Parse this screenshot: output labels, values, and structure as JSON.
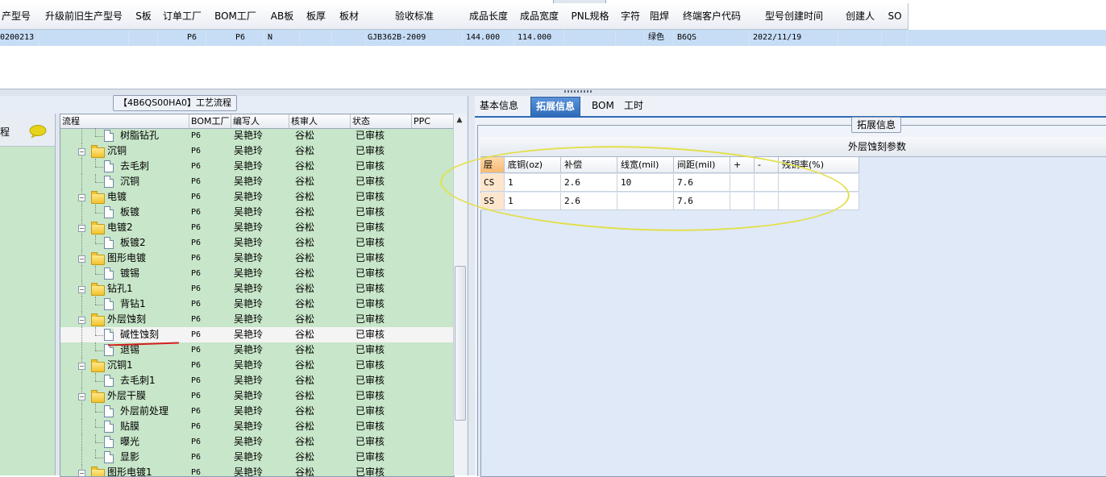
{
  "top_grid": {
    "headers": [
      "产型号",
      "升级前旧生产型号",
      "S板",
      "订单工厂",
      "BOM工厂",
      "AB板",
      "板厚",
      "板材",
      "验收标准",
      "成品长度",
      "成品宽度",
      "PNL规格",
      "字符",
      "阻焊",
      "终端客户代码",
      "型号创建时间",
      "创建人",
      "SO"
    ],
    "row": [
      "0200213",
      "",
      "",
      "P6",
      "P6",
      "N",
      "",
      "",
      "GJB362B-2009",
      "144.000",
      "114.000",
      "",
      "",
      "绿色",
      "B6QS",
      "2022/11/19",
      "",
      ""
    ]
  },
  "flow_panel": {
    "title": "【4B6QS00HA0】工艺流程",
    "side_label": "程",
    "side_icon": "chat-bubble-icon",
    "columns": [
      "流程",
      "BOM工厂",
      "编写人",
      "核审人",
      "状态",
      "PPC"
    ],
    "rows": [
      {
        "name": "树脂钻孔",
        "level": 1,
        "type": "doc",
        "bom": "P6",
        "writer": "吴艳玲",
        "reviewer": "谷松",
        "status": "已审核",
        "ppc": ""
      },
      {
        "name": "沉铜",
        "level": 0,
        "type": "folder",
        "bom": "P6",
        "writer": "吴艳玲",
        "reviewer": "谷松",
        "status": "已审核",
        "ppc": ""
      },
      {
        "name": "去毛刺",
        "level": 1,
        "type": "doc",
        "bom": "P6",
        "writer": "吴艳玲",
        "reviewer": "谷松",
        "status": "已审核",
        "ppc": ""
      },
      {
        "name": "沉铜",
        "level": 1,
        "type": "doc",
        "bom": "P6",
        "writer": "吴艳玲",
        "reviewer": "谷松",
        "status": "已审核",
        "ppc": ""
      },
      {
        "name": "电镀",
        "level": 0,
        "type": "folder",
        "bom": "P6",
        "writer": "吴艳玲",
        "reviewer": "谷松",
        "status": "已审核",
        "ppc": ""
      },
      {
        "name": "板镀",
        "level": 1,
        "type": "doc",
        "bom": "P6",
        "writer": "吴艳玲",
        "reviewer": "谷松",
        "status": "已审核",
        "ppc": ""
      },
      {
        "name": "电镀2",
        "level": 0,
        "type": "folder",
        "bom": "P6",
        "writer": "吴艳玲",
        "reviewer": "谷松",
        "status": "已审核",
        "ppc": ""
      },
      {
        "name": "板镀2",
        "level": 1,
        "type": "doc",
        "bom": "P6",
        "writer": "吴艳玲",
        "reviewer": "谷松",
        "status": "已审核",
        "ppc": ""
      },
      {
        "name": "图形电镀",
        "level": 0,
        "type": "folder",
        "bom": "P6",
        "writer": "吴艳玲",
        "reviewer": "谷松",
        "status": "已审核",
        "ppc": ""
      },
      {
        "name": "镀锡",
        "level": 1,
        "type": "doc",
        "bom": "P6",
        "writer": "吴艳玲",
        "reviewer": "谷松",
        "status": "已审核",
        "ppc": ""
      },
      {
        "name": "钻孔1",
        "level": 0,
        "type": "folder",
        "bom": "P6",
        "writer": "吴艳玲",
        "reviewer": "谷松",
        "status": "已审核",
        "ppc": ""
      },
      {
        "name": "背钻1",
        "level": 1,
        "type": "doc",
        "bom": "P6",
        "writer": "吴艳玲",
        "reviewer": "谷松",
        "status": "已审核",
        "ppc": ""
      },
      {
        "name": "外层蚀刻",
        "level": 0,
        "type": "folder",
        "bom": "P6",
        "writer": "吴艳玲",
        "reviewer": "谷松",
        "status": "已审核",
        "ppc": ""
      },
      {
        "name": "碱性蚀刻",
        "level": 1,
        "type": "doc",
        "bom": "P6",
        "writer": "吴艳玲",
        "reviewer": "谷松",
        "status": "已审核",
        "ppc": "",
        "selected": true
      },
      {
        "name": "退锡",
        "level": 1,
        "type": "doc",
        "bom": "P6",
        "writer": "吴艳玲",
        "reviewer": "谷松",
        "status": "已审核",
        "ppc": ""
      },
      {
        "name": "沉铜1",
        "level": 0,
        "type": "folder",
        "bom": "P6",
        "writer": "吴艳玲",
        "reviewer": "谷松",
        "status": "已审核",
        "ppc": ""
      },
      {
        "name": "去毛刺1",
        "level": 1,
        "type": "doc",
        "bom": "P6",
        "writer": "吴艳玲",
        "reviewer": "谷松",
        "status": "已审核",
        "ppc": ""
      },
      {
        "name": "外层干膜",
        "level": 0,
        "type": "folder",
        "bom": "P6",
        "writer": "吴艳玲",
        "reviewer": "谷松",
        "status": "已审核",
        "ppc": ""
      },
      {
        "name": "外层前处理",
        "level": 1,
        "type": "doc",
        "bom": "P6",
        "writer": "吴艳玲",
        "reviewer": "谷松",
        "status": "已审核",
        "ppc": ""
      },
      {
        "name": "贴膜",
        "level": 1,
        "type": "doc",
        "bom": "P6",
        "writer": "吴艳玲",
        "reviewer": "谷松",
        "status": "已审核",
        "ppc": ""
      },
      {
        "name": "曝光",
        "level": 1,
        "type": "doc",
        "bom": "P6",
        "writer": "吴艳玲",
        "reviewer": "谷松",
        "status": "已审核",
        "ppc": ""
      },
      {
        "name": "显影",
        "level": 1,
        "type": "doc",
        "bom": "P6",
        "writer": "吴艳玲",
        "reviewer": "谷松",
        "status": "已审核",
        "ppc": ""
      },
      {
        "name": "图形电镀1",
        "level": 0,
        "type": "folder",
        "bom": "P6",
        "writer": "吴艳玲",
        "reviewer": "谷松",
        "status": "已审核",
        "ppc": ""
      }
    ]
  },
  "tabs": [
    "基本信息",
    "拓展信息",
    "BOM",
    "工时"
  ],
  "active_tab": "拓展信息",
  "extension": {
    "group_title": "拓展信息",
    "table_title": "外层蚀刻参数",
    "columns": [
      "层",
      "底铜(oz)",
      "补偿",
      "线宽(mil)",
      "间距(mil)",
      "+",
      "-",
      "残铜率(%)"
    ],
    "rows": [
      [
        "CS",
        "1",
        "2.6",
        "10",
        "7.6",
        "",
        "",
        ""
      ],
      [
        "SS",
        "1",
        "2.6",
        "",
        "7.6",
        "",
        "",
        ""
      ]
    ]
  },
  "colors": {
    "tree_bg": "#c8e6c9",
    "selection": "#c7ddf6",
    "active_tab": "#2e6ab8",
    "highlight_ellipse": "#e2e04a",
    "annotation_line": "#d42020"
  }
}
